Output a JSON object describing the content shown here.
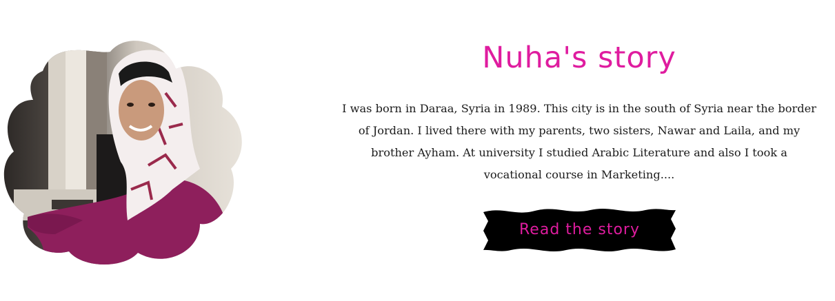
{
  "story": {
    "title": "Nuha's story",
    "text": "I was born in Daraa, Syria in 1989. This city is in the south of Syria near the border of Jordan. I lived there with my parents, two sisters, Nawar and Laila, and my brother Ayham. At university I studied Arabic Literature and also I took a vocational course in Marketing....",
    "button_label": "Read the story"
  },
  "colors": {
    "accent": "#df1c9f",
    "button_bg": "#000000",
    "text": "#1b1b1b",
    "background": "#ffffff"
  },
  "icons": {
    "photo": "portrait-photo"
  }
}
